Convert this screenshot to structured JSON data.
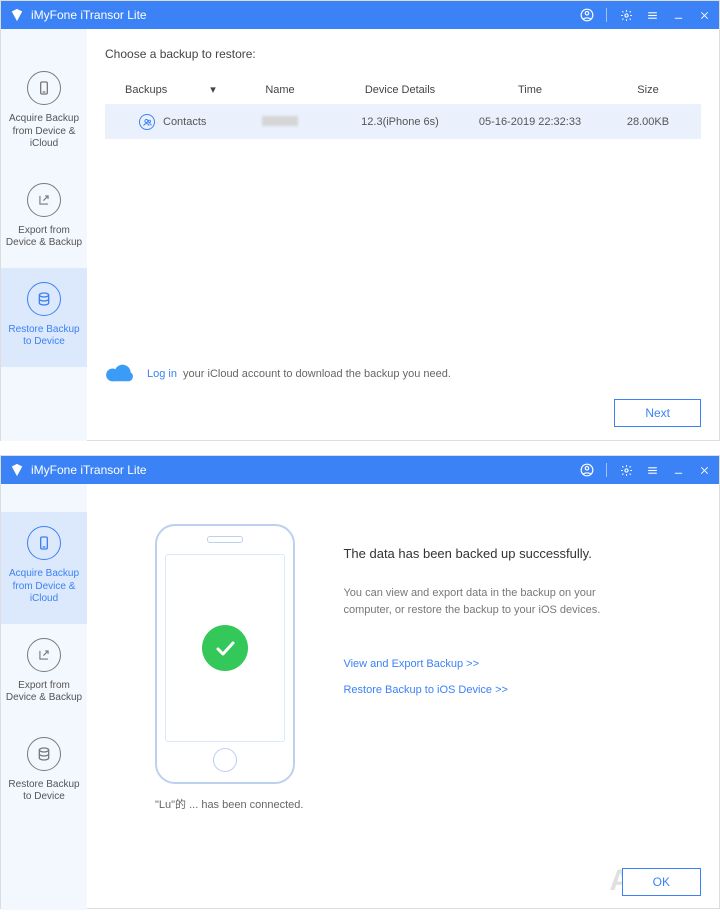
{
  "app": {
    "title": "iMyFone iTransor Lite"
  },
  "sidebar": {
    "items": [
      {
        "label": "Acquire Backup from Device & iCloud"
      },
      {
        "label": "Export from Device & Backup"
      },
      {
        "label": "Restore Backup to Device"
      }
    ]
  },
  "window1": {
    "prompt": "Choose a backup to restore:",
    "columns": {
      "backups": "Backups",
      "name": "Name",
      "device": "Device Details",
      "time": "Time",
      "size": "Size"
    },
    "row": {
      "type": "Contacts",
      "device": "12.3(iPhone 6s)",
      "time": "05-16-2019 22:32:33",
      "size": "28.00KB"
    },
    "icloud": {
      "login": "Log in",
      "rest": " your iCloud account to download the backup you need."
    },
    "next": "Next"
  },
  "window2": {
    "deviceStatus": "\"Lu\"的 ... has been connected.",
    "heading": "The data has been backed up successfully.",
    "sub": "You can view and export data in the backup on your computer, or restore the backup to your iOS devices.",
    "link1": "View and Export Backup >>",
    "link2": "Restore Backup to iOS Device >>",
    "ok": "OK",
    "watermark": "AppSo"
  }
}
